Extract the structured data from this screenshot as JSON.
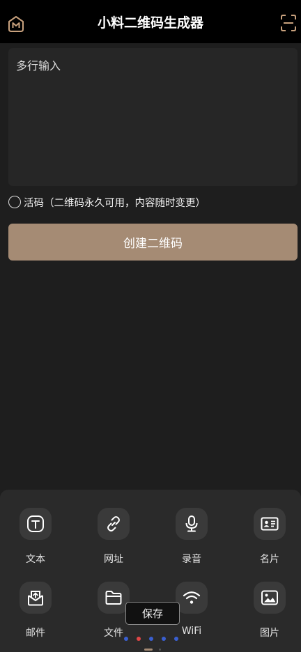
{
  "header": {
    "title": "小料二维码生成器",
    "home_icon": "home-icon",
    "scan_icon": "scan-icon"
  },
  "input": {
    "placeholder": "多行输入",
    "value": ""
  },
  "live_code": {
    "label": "活码（二维码永久可用，内容随时变更）",
    "checked": false
  },
  "create_button": {
    "label": "创建二维码",
    "color": "#a58b74"
  },
  "types": [
    {
      "label": "文本",
      "icon": "text-icon"
    },
    {
      "label": "网址",
      "icon": "link-icon"
    },
    {
      "label": "录音",
      "icon": "microphone-icon"
    },
    {
      "label": "名片",
      "icon": "business-card-icon"
    },
    {
      "label": "邮件",
      "icon": "mail-icon"
    },
    {
      "label": "文件",
      "icon": "folder-icon"
    },
    {
      "label": "WiFi",
      "icon": "wifi-icon"
    },
    {
      "label": "图片",
      "icon": "image-icon"
    }
  ],
  "pager": {
    "count": 5,
    "active_index": 1,
    "active_color": "#e04646",
    "dot_color": "#3a5fd0"
  },
  "toast": {
    "text": "保存"
  }
}
